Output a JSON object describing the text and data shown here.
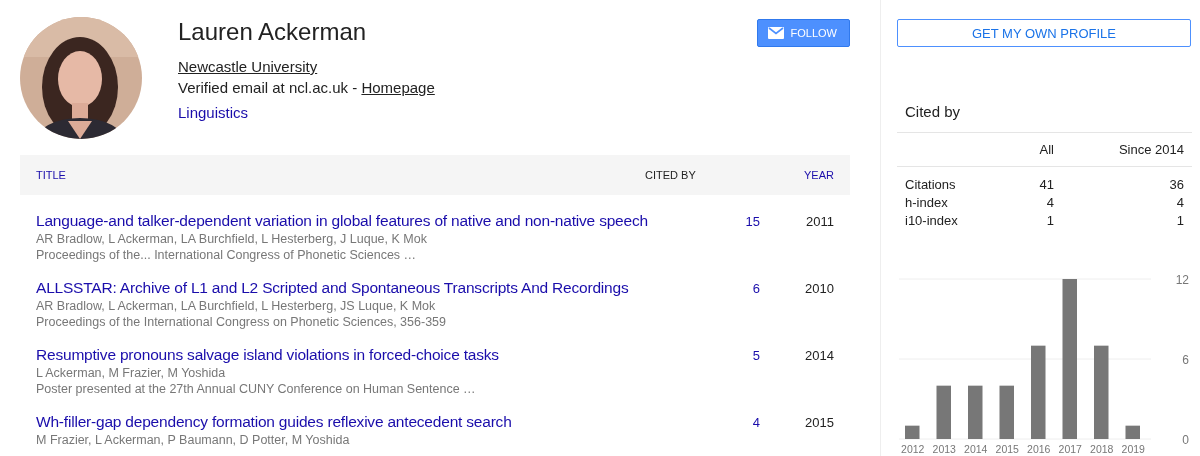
{
  "profile": {
    "name": "Lauren Ackerman",
    "affiliation": "Newcastle University",
    "email_text": "Verified email at ncl.ac.uk -",
    "homepage": "Homepage",
    "interests": [
      "Linguistics"
    ],
    "avatar": {
      "kind": "picture"
    },
    "follow_button": "FOLLOW"
  },
  "table": {
    "columns": [
      {
        "label": "TITLE",
        "kind": "sort"
      },
      {
        "label": "CITED BY",
        "kind": "plain"
      },
      {
        "label": "YEAR",
        "kind": "sort"
      }
    ],
    "rows": [
      {
        "title": "Language-and talker-dependent variation in global features of native and non-native speech",
        "authors": "AR Bradlow, L Ackerman, LA Burchfield, L Hesterberg, J Luque, K Mok",
        "venue": "Proceedings of the... International Congress of Phonetic Sciences …",
        "cited_by": "15",
        "year": "2011"
      },
      {
        "title": "ALLSSTAR: Archive of L1 and L2 Scripted and Spontaneous Transcripts And Recordings",
        "authors": "AR Bradlow, L Ackerman, LA Burchfield, L Hesterberg, JS Luque, K Mok",
        "venue": "Proceedings of the International Congress on Phonetic Sciences, 356-359",
        "cited_by": "6",
        "year": "2010"
      },
      {
        "title": "Resumptive pronouns salvage island violations in forced-choice tasks",
        "authors": "L Ackerman, M Frazier, M Yoshida",
        "venue": "Poster presented at the 27th Annual CUNY Conference on Human Sentence …",
        "cited_by": "5",
        "year": "2014"
      },
      {
        "title": "Wh-filler-gap dependency formation guides reflexive antecedent search",
        "authors": "M Frazier, L Ackerman, P Baumann, D Potter, M Yoshida",
        "cited_by": "4",
        "year": "2015"
      }
    ]
  },
  "sidebar": {
    "own_profile_button": "GET MY OWN PROFILE",
    "cited_by": {
      "title": "Cited by",
      "columns": [
        "All",
        "Since 2014"
      ],
      "rows": [
        {
          "label": "Citations",
          "all": "41",
          "since": "36"
        },
        {
          "label": "h-index",
          "all": "4",
          "since": "4"
        },
        {
          "label": "i10-index",
          "all": "1",
          "since": "1"
        }
      ]
    },
    "chart_data": {
      "type": "bar",
      "categories": [
        "2012",
        "2013",
        "2014",
        "2015",
        "2016",
        "2017",
        "2018",
        "2019"
      ],
      "values": [
        1,
        4,
        4,
        4,
        7,
        12,
        7,
        1
      ],
      "ylim": [
        0,
        12
      ],
      "yticks": [
        0,
        6,
        12
      ]
    }
  }
}
